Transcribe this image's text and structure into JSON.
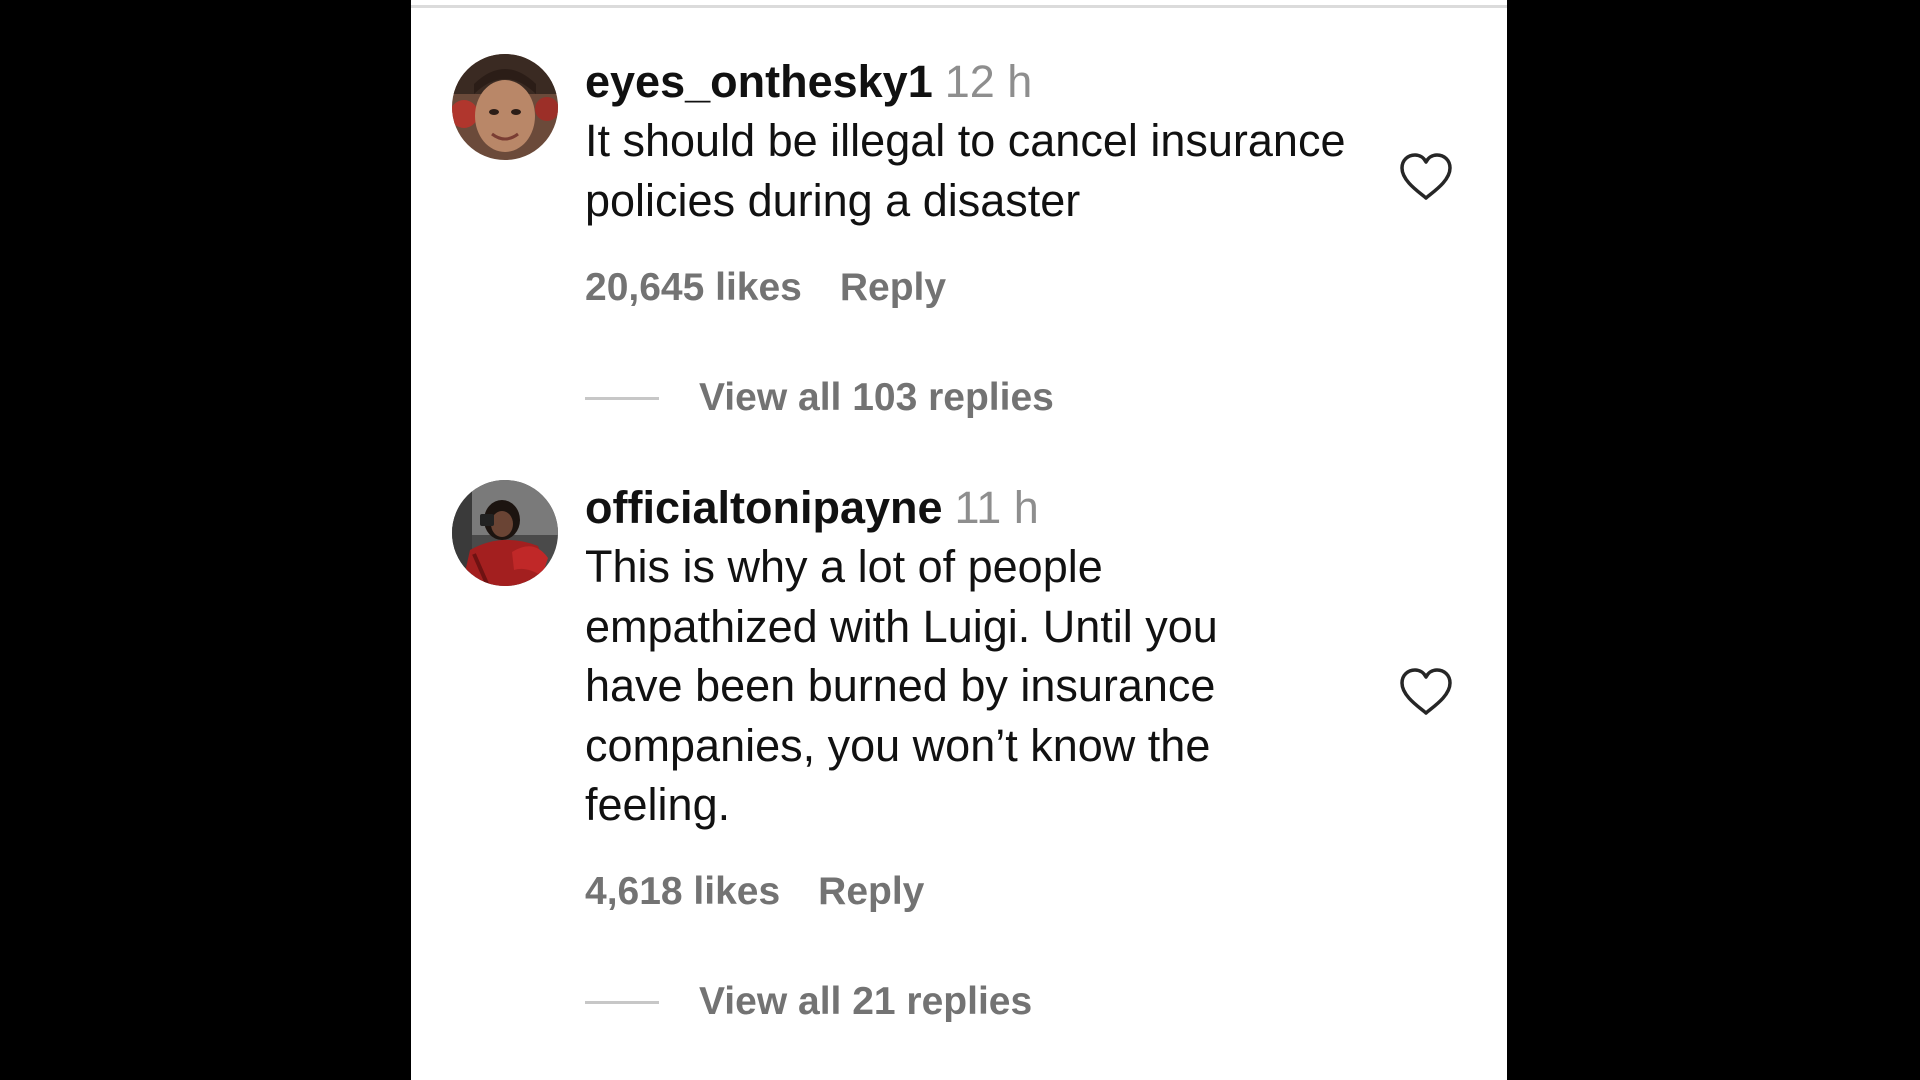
{
  "comments": [
    {
      "username": "eyes_onthesky1",
      "time": "12 h",
      "text": "It should be illegal to cancel insurance policies during a disaster",
      "likes": "20,645 likes",
      "reply_label": "Reply",
      "view_replies": "View all 103 replies",
      "heart_icon": "heart-outline-icon"
    },
    {
      "username": "officialtonipayne",
      "time": "11 h",
      "text": "This is why a lot of people empathized with Luigi. Until you have been burned by insurance companies, you won’t know the feeling.",
      "likes": "4,618 likes",
      "reply_label": "Reply",
      "view_replies": "View all 21 replies",
      "heart_icon": "heart-outline-icon"
    }
  ],
  "colors": {
    "background": "#000000",
    "panel": "#ffffff",
    "username": "#111111",
    "muted": "#737373",
    "timestamp": "#8e8e8e"
  }
}
